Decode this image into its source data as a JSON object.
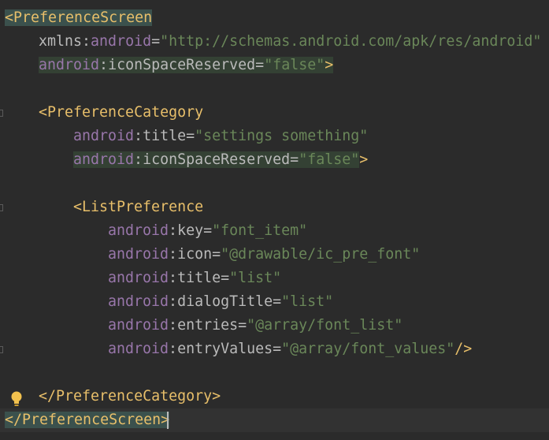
{
  "editor": {
    "lines": [
      {
        "parts": [
          {
            "t": "<",
            "c": "tag"
          },
          {
            "t": "PreferenceScreen",
            "c": "tag"
          }
        ]
      },
      {
        "parts": [
          {
            "t": "xmlns",
            "c": "attr"
          },
          {
            "t": ":",
            "c": "colon"
          },
          {
            "t": "android",
            "c": "ns"
          },
          {
            "t": "=",
            "c": "eq"
          },
          {
            "t": "\"http://schemas.android.com/apk/res/android\"",
            "c": "str"
          }
        ]
      },
      {
        "parts": [
          {
            "t": "android",
            "c": "ns"
          },
          {
            "t": ":",
            "c": "colon"
          },
          {
            "t": "iconSpaceReserved",
            "c": "attr"
          },
          {
            "t": "=",
            "c": "eq"
          },
          {
            "t": "\"false\"",
            "c": "str"
          },
          {
            "t": ">",
            "c": "tag"
          }
        ]
      },
      {
        "parts": []
      },
      {
        "parts": [
          {
            "t": "<PreferenceCategory",
            "c": "tag"
          }
        ]
      },
      {
        "parts": [
          {
            "t": "android",
            "c": "ns"
          },
          {
            "t": ":",
            "c": "colon"
          },
          {
            "t": "title",
            "c": "attr"
          },
          {
            "t": "=",
            "c": "eq"
          },
          {
            "t": "\"settings something\"",
            "c": "str"
          }
        ]
      },
      {
        "parts": [
          {
            "t": "android",
            "c": "ns"
          },
          {
            "t": ":",
            "c": "colon"
          },
          {
            "t": "iconSpaceReserved",
            "c": "attr"
          },
          {
            "t": "=",
            "c": "eq"
          },
          {
            "t": "\"false\"",
            "c": "str"
          },
          {
            "t": ">",
            "c": "tag"
          }
        ]
      },
      {
        "parts": []
      },
      {
        "parts": [
          {
            "t": "<ListPreference",
            "c": "tag"
          }
        ]
      },
      {
        "parts": [
          {
            "t": "android",
            "c": "ns"
          },
          {
            "t": ":",
            "c": "colon"
          },
          {
            "t": "key",
            "c": "attr"
          },
          {
            "t": "=",
            "c": "eq"
          },
          {
            "t": "\"font_item\"",
            "c": "str"
          }
        ]
      },
      {
        "parts": [
          {
            "t": "android",
            "c": "ns"
          },
          {
            "t": ":",
            "c": "colon"
          },
          {
            "t": "icon",
            "c": "attr"
          },
          {
            "t": "=",
            "c": "eq"
          },
          {
            "t": "\"@drawable/ic_pre_font\"",
            "c": "str"
          }
        ]
      },
      {
        "parts": [
          {
            "t": "android",
            "c": "ns"
          },
          {
            "t": ":",
            "c": "colon"
          },
          {
            "t": "title",
            "c": "attr"
          },
          {
            "t": "=",
            "c": "eq"
          },
          {
            "t": "\"list\"",
            "c": "str"
          }
        ]
      },
      {
        "parts": [
          {
            "t": "android",
            "c": "ns"
          },
          {
            "t": ":",
            "c": "colon"
          },
          {
            "t": "dialogTitle",
            "c": "attr"
          },
          {
            "t": "=",
            "c": "eq"
          },
          {
            "t": "\"list\"",
            "c": "str"
          }
        ]
      },
      {
        "parts": [
          {
            "t": "android",
            "c": "ns"
          },
          {
            "t": ":",
            "c": "colon"
          },
          {
            "t": "entries",
            "c": "attr"
          },
          {
            "t": "=",
            "c": "eq"
          },
          {
            "t": "\"@array/font_list\"",
            "c": "str"
          }
        ]
      },
      {
        "parts": [
          {
            "t": "android",
            "c": "ns"
          },
          {
            "t": ":",
            "c": "colon"
          },
          {
            "t": "entryValues",
            "c": "attr"
          },
          {
            "t": "=",
            "c": "eq"
          },
          {
            "t": "\"@array/font_values\"",
            "c": "str"
          },
          {
            "t": "/>",
            "c": "tag"
          }
        ]
      },
      {
        "parts": []
      },
      {
        "parts": [
          {
            "t": "</PreferenceCategory>",
            "c": "tag"
          }
        ]
      },
      {
        "parts": [
          {
            "t": "</",
            "c": "tag"
          },
          {
            "t": "PreferenceScreen",
            "c": "tag"
          },
          {
            "t": ">",
            "c": "tag"
          }
        ]
      }
    ],
    "icons": {
      "fold_markers": "fold-marker-icon",
      "intention_bulb": "lightbulb-icon"
    },
    "colors": {
      "background": "#2b2b2b",
      "tag": "#e8bf6a",
      "namespace": "#9876aa",
      "attribute": "#bababa",
      "string": "#6a8759",
      "bulb": "#f2c14e"
    }
  }
}
